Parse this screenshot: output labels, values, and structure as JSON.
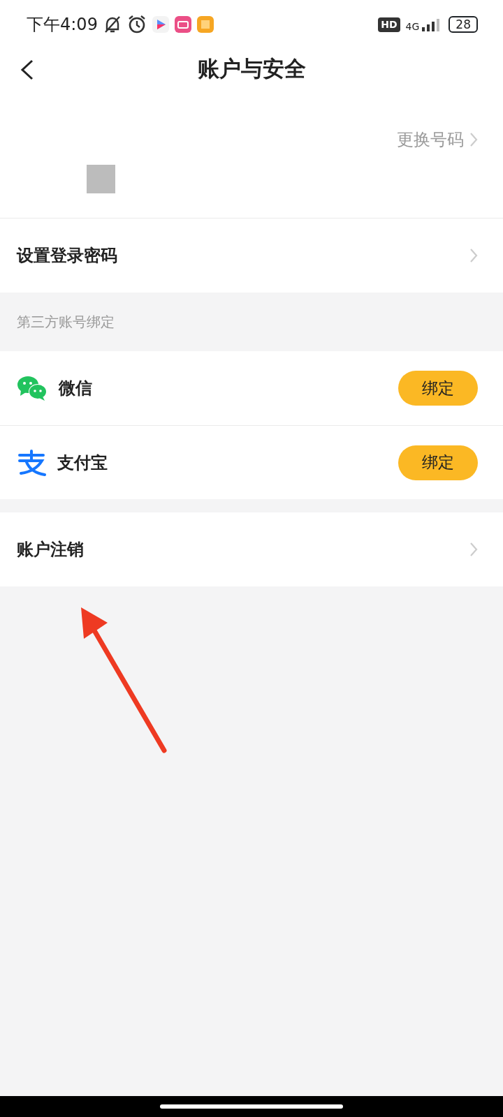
{
  "status_bar": {
    "time": "下午4:09",
    "hd": "HD",
    "network": "4G",
    "battery": "28"
  },
  "header": {
    "title": "账户与安全"
  },
  "phone": {
    "action": "更换号码"
  },
  "password_row": {
    "label": "设置登录密码"
  },
  "third_party": {
    "title": "第三方账号绑定",
    "items": [
      {
        "kind": "wechat",
        "name": "微信",
        "button": "绑定"
      },
      {
        "kind": "alipay",
        "name": "支付宝",
        "button": "绑定"
      }
    ]
  },
  "cancel_row": {
    "label": "账户注销"
  }
}
